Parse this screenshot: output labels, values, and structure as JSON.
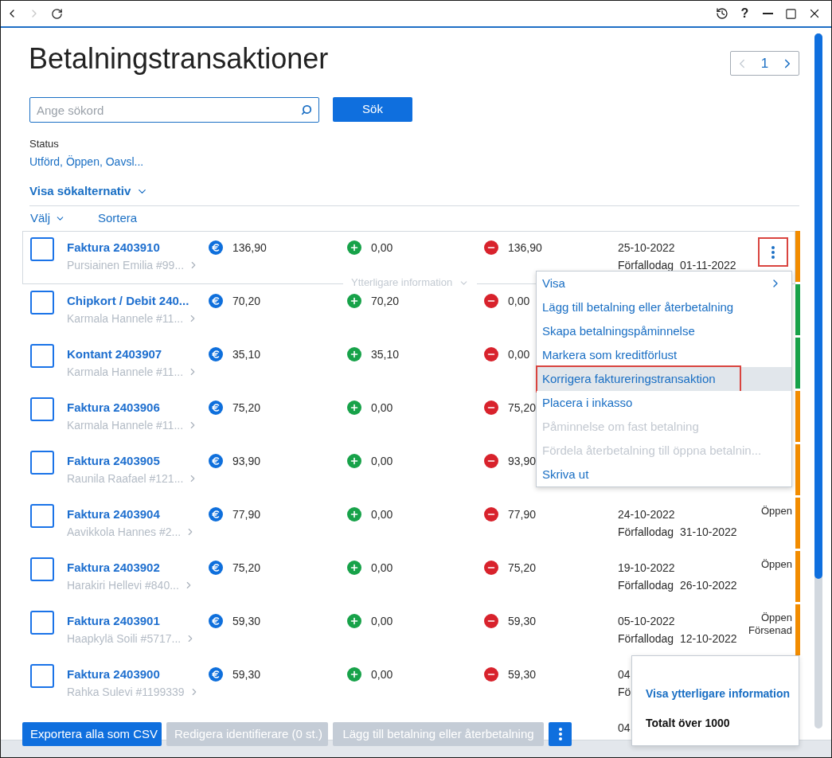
{
  "nav": {
    "back_disabled": false,
    "forward_disabled": true
  },
  "window_controls": {
    "help_label": "?"
  },
  "title": "Betalningstransaktioner",
  "pager": {
    "page": "1",
    "prev_disabled": true,
    "next_disabled": false
  },
  "search": {
    "placeholder": "Ange sökord",
    "button": "Sök"
  },
  "status_filter": {
    "label": "Status",
    "value": "Utförd, Öppen, Oavsl..."
  },
  "search_options": {
    "label": "Visa sökalternativ",
    "expanded": false
  },
  "list_header": {
    "select": "Välj",
    "sort": "Sortera"
  },
  "rows": [
    {
      "kind": "entry",
      "title": "Faktura 2403910",
      "customer": "Pursiainen Emilia #99...",
      "amount": "136,90",
      "paid": "0,00",
      "remaining": "136,90",
      "date": "25-10-2022",
      "due_label": "Förfallodag",
      "due_date": "01-11-2022",
      "color": "#f28c00",
      "checked": false,
      "hovered": true,
      "more_label": "Ytterligare information",
      "actions": {
        "highlighted": true
      }
    },
    {
      "kind": "entry",
      "title": "Chipkort / Debit 240...",
      "customer": "Karmala Hannele #11...",
      "amount": "70,20",
      "paid": "70,20",
      "remaining": "0,00",
      "color": "#17a249",
      "checked": false,
      "hovered": false
    },
    {
      "kind": "entry",
      "title": "Kontant 2403907",
      "customer": "Karmala Hannele #11...",
      "amount": "35,10",
      "paid": "35,10",
      "remaining": "0,00",
      "color": "#17a249",
      "checked": false,
      "hovered": false
    },
    {
      "kind": "entry",
      "title": "Faktura 2403906",
      "customer": "Karmala Hannele #11...",
      "amount": "75,20",
      "paid": "0,00",
      "remaining": "75,20",
      "color": "#f28c00",
      "checked": false,
      "hovered": false
    },
    {
      "kind": "entry",
      "title": "Faktura 2403905",
      "customer": "Raunila Raafael #121...",
      "amount": "93,90",
      "paid": "0,00",
      "remaining": "93,90",
      "color": "#f28c00",
      "checked": false,
      "hovered": false
    },
    {
      "kind": "entry",
      "title": "Faktura 2403904",
      "customer": "Aavikkola Hannes #2...",
      "amount": "77,90",
      "paid": "0,00",
      "remaining": "77,90",
      "date": "24-10-2022",
      "due_label": "Förfallodag",
      "due_date": "31-10-2022",
      "status": [
        "Öppen"
      ],
      "color": "#f28c00",
      "checked": false,
      "hovered": false
    },
    {
      "kind": "entry",
      "title": "Faktura 2403902",
      "customer": "Harakiri Hellevi #840...",
      "amount": "75,20",
      "paid": "0,00",
      "remaining": "75,20",
      "date": "19-10-2022",
      "due_label": "Förfallodag",
      "due_date": "26-10-2022",
      "status": [
        "Öppen"
      ],
      "color": "#f28c00",
      "checked": false,
      "hovered": false
    },
    {
      "kind": "entry",
      "title": "Faktura 2403901",
      "customer": "Haapkylä Soili #5717...",
      "amount": "59,30",
      "paid": "0,00",
      "remaining": "59,30",
      "date": "05-10-2022",
      "due_label": "Förfallodag",
      "due_date": "12-10-2022",
      "status": [
        "Öppen",
        "Försenad"
      ],
      "color": "#f28c00",
      "checked": false,
      "hovered": false
    },
    {
      "kind": "entry",
      "title": "Faktura 2403900",
      "customer": "Rahka Sulevi #1199339",
      "amount": "59,30",
      "paid": "0,00",
      "remaining": "59,30",
      "date": "04",
      "due_label": "Fö",
      "checked": false,
      "hovered": false
    },
    {
      "kind": "partial",
      "date": "04"
    }
  ],
  "row_menu": {
    "items": [
      {
        "label": "Visa",
        "submenu": true,
        "disabled": false,
        "selected": false,
        "highlighted": false
      },
      {
        "label": "Lägg till betalning eller återbetalning",
        "submenu": false,
        "disabled": false,
        "selected": false,
        "highlighted": false
      },
      {
        "label": "Skapa betalningspåminnelse",
        "submenu": false,
        "disabled": false,
        "selected": false,
        "highlighted": false
      },
      {
        "label": "Markera som kreditförlust",
        "submenu": false,
        "disabled": false,
        "selected": false,
        "highlighted": false
      },
      {
        "label": "Korrigera faktureringstransaktion",
        "submenu": false,
        "disabled": false,
        "selected": true,
        "highlighted": true
      },
      {
        "label": "Placera i inkasso",
        "submenu": false,
        "disabled": false,
        "selected": false,
        "highlighted": false
      },
      {
        "label": "Påminnelse om fast betalning",
        "submenu": false,
        "disabled": true,
        "selected": false,
        "highlighted": false
      },
      {
        "label": "Fördela återbetalning till öppna betalnin...",
        "submenu": false,
        "disabled": true,
        "selected": false,
        "highlighted": false
      },
      {
        "label": "Skriva ut",
        "submenu": false,
        "disabled": false,
        "selected": false,
        "highlighted": false
      }
    ]
  },
  "summary_popup": {
    "link": "Visa ytterligare information",
    "total": "Totalt över 1000"
  },
  "footer": {
    "buttons": [
      {
        "label": "Exportera alla som CSV",
        "disabled": false
      },
      {
        "label": "Redigera identifierare (0 st.)",
        "disabled": true
      },
      {
        "label": "Lägg till betalning eller återbetalning",
        "disabled": true
      }
    ]
  }
}
